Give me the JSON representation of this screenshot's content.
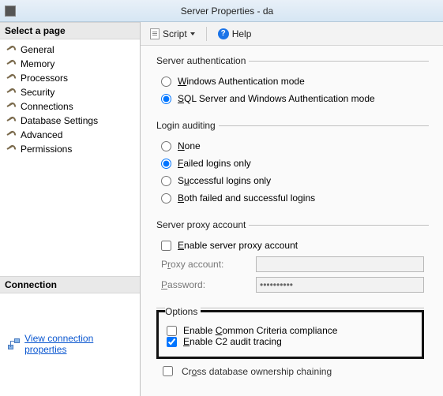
{
  "window": {
    "title": "Server Properties - da"
  },
  "sidebar": {
    "header": "Select a page",
    "items": [
      {
        "label": "General"
      },
      {
        "label": "Memory"
      },
      {
        "label": "Processors"
      },
      {
        "label": "Security",
        "selected": true
      },
      {
        "label": "Connections"
      },
      {
        "label": "Database Settings"
      },
      {
        "label": "Advanced"
      },
      {
        "label": "Permissions"
      }
    ]
  },
  "connection": {
    "header": "Connection",
    "link": "View connection properties"
  },
  "toolbar": {
    "script": "Script",
    "help": "Help"
  },
  "auth": {
    "legend": "Server authentication",
    "opt_windows": "Windows Authentication mode",
    "opt_mixed": "SQL Server and Windows Authentication mode",
    "selected": "mixed"
  },
  "audit": {
    "legend": "Login auditing",
    "opt_none": "None",
    "opt_failed": "Failed logins only",
    "opt_success": "Successful logins only",
    "opt_both": "Both failed and successful logins",
    "selected": "failed"
  },
  "proxy": {
    "legend": "Server proxy account",
    "enable": "Enable server proxy account",
    "enabled": false,
    "account_label": "Proxy account:",
    "account_value": "",
    "password_label": "Password:",
    "password_value": "**********"
  },
  "options": {
    "legend": "Options",
    "cb_ccc": "Enable Common Criteria compliance",
    "cb_ccc_checked": false,
    "cb_c2": "Enable C2 audit tracing",
    "cb_c2_checked": true,
    "cb_cross": "Cross database ownership chaining",
    "cb_cross_checked": false
  }
}
